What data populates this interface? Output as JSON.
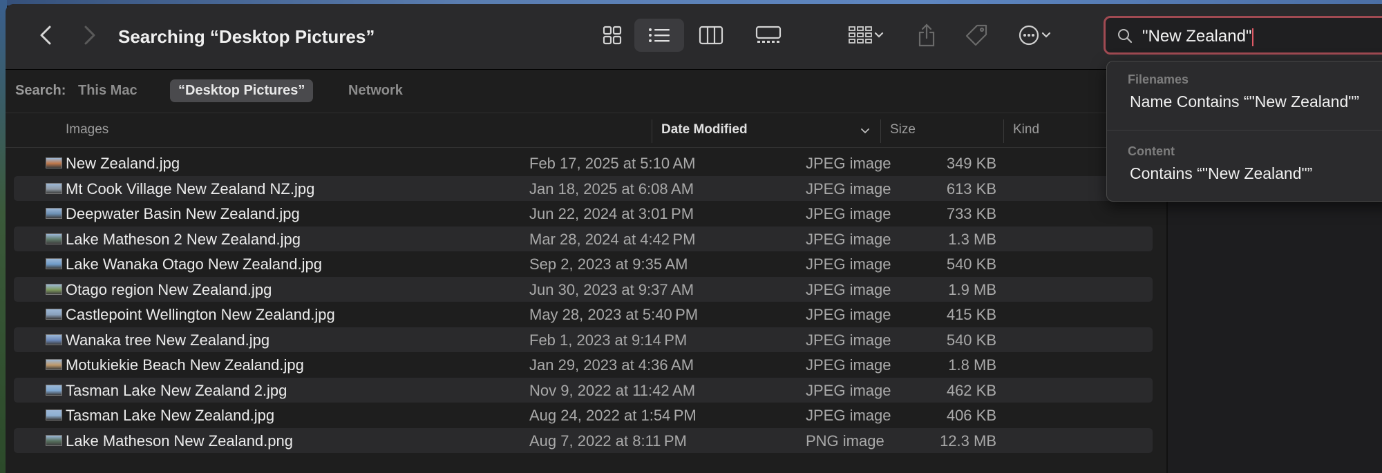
{
  "window": {
    "title": "Searching “Desktop Pictures”"
  },
  "toolbar": {
    "view_modes": [
      "icon-view",
      "list-view",
      "column-view",
      "gallery-view"
    ],
    "selected_view": "list-view"
  },
  "search": {
    "value": "\"New Zealand\"",
    "accent": "#a04a52"
  },
  "scope": {
    "label": "Search:",
    "options": [
      "This Mac",
      "“Desktop Pictures”",
      "Network"
    ],
    "selected_index": 1
  },
  "columns": {
    "name": "Images",
    "date": "Date Modified",
    "size": "Size",
    "kind": "Kind"
  },
  "files": [
    {
      "name": "New Zealand.jpg",
      "date": "Feb 17, 2025 at 5:10 AM",
      "size": "349 KB",
      "kind": "JPEG image",
      "thumb": "#c0784a"
    },
    {
      "name": "Mt Cook Village New Zealand NZ.jpg",
      "date": "Jan 18, 2025 at 6:08 AM",
      "size": "613 KB",
      "kind": "JPEG image",
      "thumb": "#8f9aa6"
    },
    {
      "name": "Deepwater Basin New Zealand.jpg",
      "date": "Jun 22, 2024 at 3:01 PM",
      "size": "733 KB",
      "kind": "JPEG image",
      "thumb": "#6b8fb3"
    },
    {
      "name": "Lake Matheson 2 New Zealand.jpg",
      "date": "Mar 28, 2024 at 4:42 PM",
      "size": "1.3 MB",
      "kind": "JPEG image",
      "thumb": "#5f7a6a"
    },
    {
      "name": "Lake Wanaka Otago New Zealand.jpg",
      "date": "Sep 2, 2023 at 9:35 AM",
      "size": "540 KB",
      "kind": "JPEG image",
      "thumb": "#6f9cc9"
    },
    {
      "name": "Otago region New Zealand.jpg",
      "date": "Jun 30, 2023 at 9:37 AM",
      "size": "1.9 MB",
      "kind": "JPEG image",
      "thumb": "#7e9a5d"
    },
    {
      "name": "Castlepoint Wellington New Zealand.jpg",
      "date": "May 28, 2023 at 5:40 PM",
      "size": "415 KB",
      "kind": "JPEG image",
      "thumb": "#8aa2bd"
    },
    {
      "name": "Wanaka tree New Zealand.jpg",
      "date": "Feb 1, 2023 at 9:14 PM",
      "size": "540 KB",
      "kind": "JPEG image",
      "thumb": "#6a87b8"
    },
    {
      "name": "Motukiekie Beach New Zealand.jpg",
      "date": "Jan 29, 2023 at 4:36 AM",
      "size": "1.8 MB",
      "kind": "JPEG image",
      "thumb": "#c0996a"
    },
    {
      "name": "Tasman Lake New Zealand 2.jpg",
      "date": "Nov 9, 2022 at 11:42 AM",
      "size": "462 KB",
      "kind": "JPEG image",
      "thumb": "#7ea6cf"
    },
    {
      "name": "Tasman Lake New Zealand.jpg",
      "date": "Aug 24, 2022 at 1:54 PM",
      "size": "406 KB",
      "kind": "JPEG image",
      "thumb": "#8fb0d2"
    },
    {
      "name": "Lake Matheson New Zealand.png",
      "date": "Aug 7, 2022 at 8:11 PM",
      "size": "12.3 MB",
      "kind": "PNG image",
      "thumb": "#56705e"
    }
  ],
  "suggestions": {
    "filenames_header": "Filenames",
    "filenames_item": "Name Contains “\"New Zealand\"”",
    "content_header": "Content",
    "content_item": "Contains “\"New Zealand\"”"
  }
}
